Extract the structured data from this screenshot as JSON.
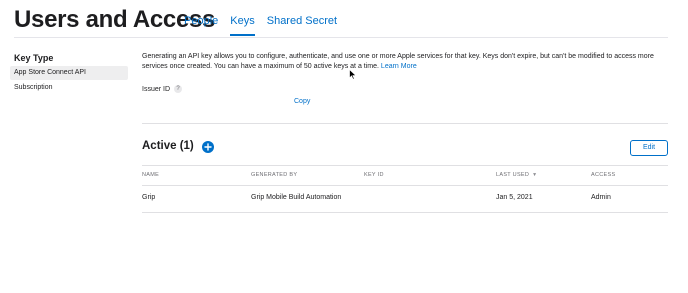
{
  "header": {
    "title": "Users and Access",
    "tabs": [
      {
        "label": "People"
      },
      {
        "label": "Keys"
      },
      {
        "label": "Shared Secret"
      }
    ],
    "active_tab": "Keys"
  },
  "sidebar": {
    "heading": "Key Type",
    "items": [
      {
        "label": "App Store Connect API",
        "selected": true
      },
      {
        "label": "Subscription",
        "selected": false
      }
    ]
  },
  "main": {
    "description": "Generating an API key allows you to configure, authenticate, and use one or more Apple services for that key. Keys don't expire, but can't be modified to access more services once created. You can have a maximum of 50 active keys at a time.",
    "learn_more": "Learn More",
    "issuer_label": "Issuer ID",
    "help_icon": "?",
    "copy_label": "Copy",
    "active_title": "Active (1)",
    "edit_label": "Edit",
    "table": {
      "columns": [
        "NAME",
        "GENERATED BY",
        "KEY ID",
        "LAST USED",
        "ACCESS"
      ],
      "rows": [
        {
          "name": "Grip",
          "generated_by": "Grip Mobile Build Automation",
          "key_id": "",
          "last_used": "Jan 5, 2021",
          "access": "Admin"
        }
      ]
    }
  },
  "icons": {
    "add": "plus-circle-icon",
    "sort": "chevron-down-icon",
    "help": "question-circle-icon",
    "cursor": "mouse-pointer-icon"
  },
  "colors": {
    "accent": "#0070c9",
    "text": "#1d1d1f",
    "muted": "#6e6e73",
    "divider": "#e0e0e3",
    "selected_bg": "#eeeeef"
  }
}
